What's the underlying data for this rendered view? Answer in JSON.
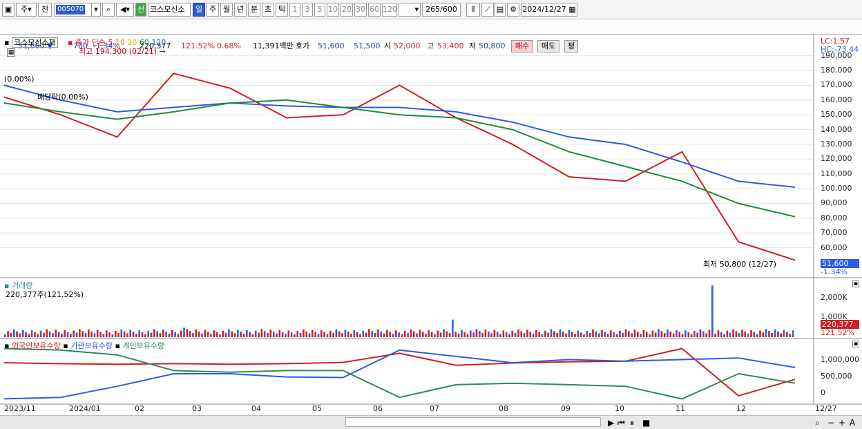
{
  "toolbar": {
    "period_week": "주",
    "prev_label": "전",
    "code": "005070",
    "stock_name": "코스모신소",
    "new_badge": "신",
    "intervals": [
      "일",
      "주",
      "월",
      "년",
      "분",
      "초",
      "틱"
    ],
    "selected_interval": "일",
    "numbers": [
      "1",
      "3",
      "5",
      "10",
      "20",
      "30",
      "60",
      "120"
    ],
    "count": "265",
    "count_max": "/600",
    "date": "2024/12/27"
  },
  "quote": {
    "price": "51,600",
    "change": "700",
    "change_pct": "-1.34%",
    "volume": "220,377",
    "volume_ratio": "121.52%",
    "turnover_pct": "0.68%",
    "amount": "11,391백만",
    "bid_ask_label": "호가",
    "ask": "51,600",
    "bid": "51,500",
    "open_label": "시",
    "open": "52,000",
    "high_label": "고",
    "high": "53,400",
    "low_label": "저",
    "low": "50,800",
    "buy_label": "매수",
    "sell_label": "매도",
    "eval_label": "평"
  },
  "price_panel": {
    "name": "코스모신소재",
    "ma_label": "종가 단순",
    "ma_periods": [
      "5",
      "10",
      "20",
      "60",
      "120"
    ],
    "ma_colors": [
      "#d21e1e",
      "#f08c1e",
      "#f0e41e",
      "#1e8c3c",
      "#2b5ce6"
    ],
    "high_note": "최고 194,300 (02/21)",
    "low_note": "최저 50,800 (12/27)",
    "left_note": "(0.00%)",
    "dividend_note": "배당락(0.00%)",
    "lc": "LC:1.57",
    "hc": "HC:-73.44",
    "price_tag": "51,600",
    "price_tag_pct": "-1.34%",
    "y_ticks": [
      "190,000",
      "180,000",
      "170,000",
      "160,000",
      "150,000",
      "140,000",
      "130,000",
      "120,000",
      "110,000",
      "100,000",
      "90,000",
      "80,000",
      "70,000",
      "60,000"
    ]
  },
  "volume_panel": {
    "title": "거래량",
    "value": "220,377주(121.52%)",
    "y_ticks": [
      "2,000K",
      "1,000K"
    ],
    "tag": "220,377",
    "tag_pct": "121.52%"
  },
  "holdings_panel": {
    "series": [
      "외국인보유수량",
      "기관보유수량",
      "개인보유수량"
    ],
    "colors": [
      "#d21e1e",
      "#2b5ce6",
      "#2e8b57"
    ],
    "y_ticks": [
      "1,000,000",
      "500,000",
      "0"
    ]
  },
  "x_axis": [
    "2023/11",
    "2024/01",
    "02",
    "03",
    "04",
    "05",
    "06",
    "07",
    "08",
    "09",
    "10",
    "11",
    "12",
    "12/27"
  ],
  "chart_data": {
    "type": "line",
    "title": "코스모신소재",
    "x": [
      "2023/11",
      "2024/01",
      "02",
      "03",
      "04",
      "05",
      "06",
      "07",
      "08",
      "09",
      "10",
      "11",
      "12",
      "12/27"
    ],
    "series": [
      {
        "name": "5",
        "values": [
          162000,
          150000,
          135000,
          178000,
          168000,
          148000,
          150000,
          170000,
          148000,
          130000,
          108000,
          105000,
          125000,
          64000,
          51600
        ]
      },
      {
        "name": "120",
        "values": [
          170000,
          160000,
          152000,
          155000,
          158000,
          156000,
          155000,
          155000,
          152000,
          145000,
          135000,
          130000,
          118000,
          105000,
          101000
        ]
      },
      {
        "name": "60",
        "values": [
          158000,
          152000,
          147000,
          152000,
          158000,
          160000,
          155000,
          150000,
          148000,
          140000,
          125000,
          115000,
          105000,
          90000,
          81000
        ]
      }
    ],
    "ylim": [
      50000,
      195000
    ],
    "grid": true,
    "volume_max": 2400000,
    "holdings": [
      {
        "name": "외국인보유수량",
        "values": [
          950000,
          920000,
          900000,
          920000,
          900000,
          920000,
          960000,
          1250000,
          870000,
          940000,
          980000,
          1000000,
          1400000,
          -100000,
          420000
        ]
      },
      {
        "name": "기관보유수량",
        "values": [
          -200000,
          -150000,
          200000,
          600000,
          600000,
          500000,
          480000,
          1350000,
          1150000,
          950000,
          1050000,
          1000000,
          1050000,
          1100000,
          800000
        ]
      },
      {
        "name": "개인보유수량",
        "values": [
          1400000,
          1350000,
          1200000,
          700000,
          650000,
          700000,
          700000,
          -150000,
          250000,
          300000,
          250000,
          200000,
          -200000,
          600000,
          300000
        ]
      }
    ]
  }
}
